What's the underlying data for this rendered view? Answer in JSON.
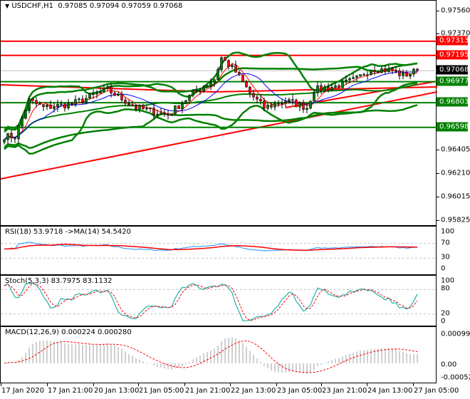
{
  "header": {
    "symbol": "USDCHF,H1",
    "ohlc": "0.97085 0.97094 0.97059 0.97068"
  },
  "price_axis": {
    "labels": [
      "0.97560",
      "0.97370",
      "0.96405",
      "0.96210",
      "0.96015",
      "0.95825"
    ],
    "values": [
      0.9756,
      0.9737,
      0.96405,
      0.9621,
      0.96015,
      0.95825
    ],
    "range": [
      0.95787,
      0.97649
    ]
  },
  "levels": [
    {
      "label": "0.97313",
      "value": 0.97313,
      "color": "#ff0000",
      "kind": "resistance"
    },
    {
      "label": "0.97195",
      "value": 0.97195,
      "color": "#ff0000",
      "kind": "resistance"
    },
    {
      "label": "0.97068",
      "value": 0.97068,
      "color": "#000000",
      "kind": "current-price"
    },
    {
      "label": "0.96977",
      "value": 0.96977,
      "color": "#008000",
      "kind": "support"
    },
    {
      "label": "0.96803",
      "value": 0.96803,
      "color": "#008000",
      "kind": "support"
    },
    {
      "label": "0.96598",
      "value": 0.96598,
      "color": "#008000",
      "kind": "support"
    }
  ],
  "price_keys": [
    [
      0,
      0.96526
    ],
    [
      3,
      0.9652
    ],
    [
      7,
      0.96821
    ],
    [
      11,
      0.96762
    ],
    [
      19,
      0.96792
    ],
    [
      29,
      0.9691
    ],
    [
      37,
      0.96762
    ],
    [
      46,
      0.96703
    ],
    [
      53,
      0.9688
    ],
    [
      59,
      0.96999
    ],
    [
      61,
      0.97176
    ],
    [
      65,
      0.97058
    ],
    [
      69,
      0.9688
    ],
    [
      73,
      0.96762
    ],
    [
      79,
      0.96821
    ],
    [
      85,
      0.96762
    ],
    [
      87,
      0.9691
    ],
    [
      93,
      0.96939
    ],
    [
      99,
      0.96999
    ],
    [
      103,
      0.97087
    ],
    [
      109,
      0.97069
    ],
    [
      112,
      0.97028
    ],
    [
      116,
      0.97068
    ]
  ],
  "rsi": {
    "label": "RSI(18) 53.9718  ->MA(14) 54.5420",
    "axis": [
      "100",
      "70",
      "30",
      "0"
    ]
  },
  "stoch": {
    "label": "Stoch(5,3,3) 83.7975 83.1132",
    "axis": [
      "100",
      "80",
      "20",
      "0"
    ]
  },
  "macd": {
    "label": "MACD(12,26,9) 0.000224 0.000280",
    "axis": [
      "0.000991",
      "0.00",
      "-0.000525"
    ]
  },
  "time_axis": [
    "17 Jan 2020",
    "17 Jan 21:00",
    "20 Jan 13:00",
    "21 Jan 05:00",
    "21 Jan 21:00",
    "22 Jan 13:00",
    "23 Jan 05:00",
    "23 Jan 21:00",
    "24 Jan 13:00",
    "27 Jan 05:00"
  ],
  "colors": {
    "bull": "#008000",
    "bear": "#ff0000",
    "band": "#008000",
    "ma_fast": "#ff0000",
    "ma_slow": "#0000ff",
    "stoch_main": "#20b2aa",
    "rsi": "#1e90ff"
  }
}
